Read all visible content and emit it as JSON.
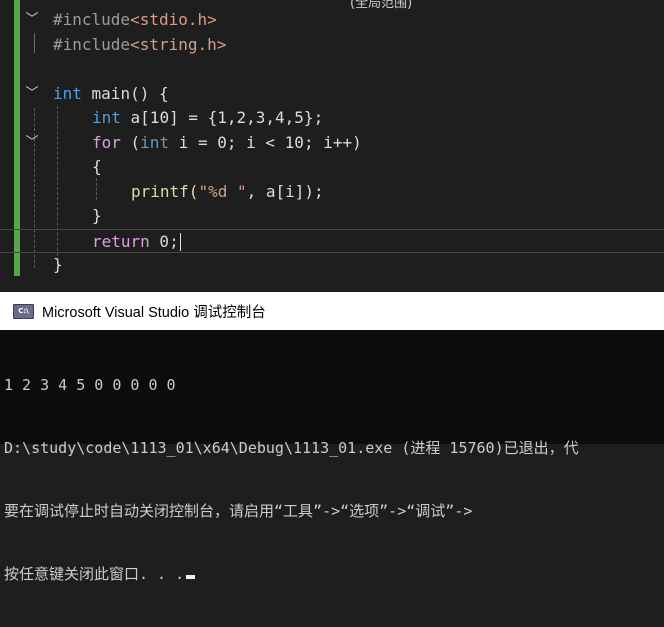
{
  "editor": {
    "top_cut_text": "(全局范围)",
    "lines": [
      {
        "tokens": [
          "#include",
          "<stdio.h>"
        ]
      },
      {
        "tokens": [
          "#include",
          "<string.h>"
        ]
      },
      {
        "tokens": []
      },
      {
        "tokens": [
          "int",
          " main() {"
        ]
      },
      {
        "tokens": [
          "int",
          " a[10] = {1,2,3,4,5};"
        ]
      },
      {
        "tokens": [
          "for",
          " (",
          "int",
          " i = 0; i < 10; i++)"
        ]
      },
      {
        "tokens": [
          "{"
        ]
      },
      {
        "tokens": [
          "printf(",
          "\"%d \"",
          ", a[i]);"
        ]
      },
      {
        "tokens": [
          "}"
        ]
      },
      {
        "tokens": [
          "return",
          " 0;"
        ]
      },
      {
        "tokens": [
          "}"
        ]
      }
    ],
    "fold_icon": "chevron-down-icon"
  },
  "console": {
    "icon": "console-app-icon",
    "icon_text": "C:\\",
    "title": "Microsoft Visual Studio 调试控制台",
    "output_lines": [
      "1 2 3 4 5 0 0 0 0 0",
      "D:\\study\\code\\1113_01\\x64\\Debug\\1113_01.exe (进程 15760)已退出，代",
      "要在调试停止时自动关闭控制台，请启用“工具”->“选项”->“调试”->",
      "按任意键关闭此窗口. . ."
    ]
  }
}
